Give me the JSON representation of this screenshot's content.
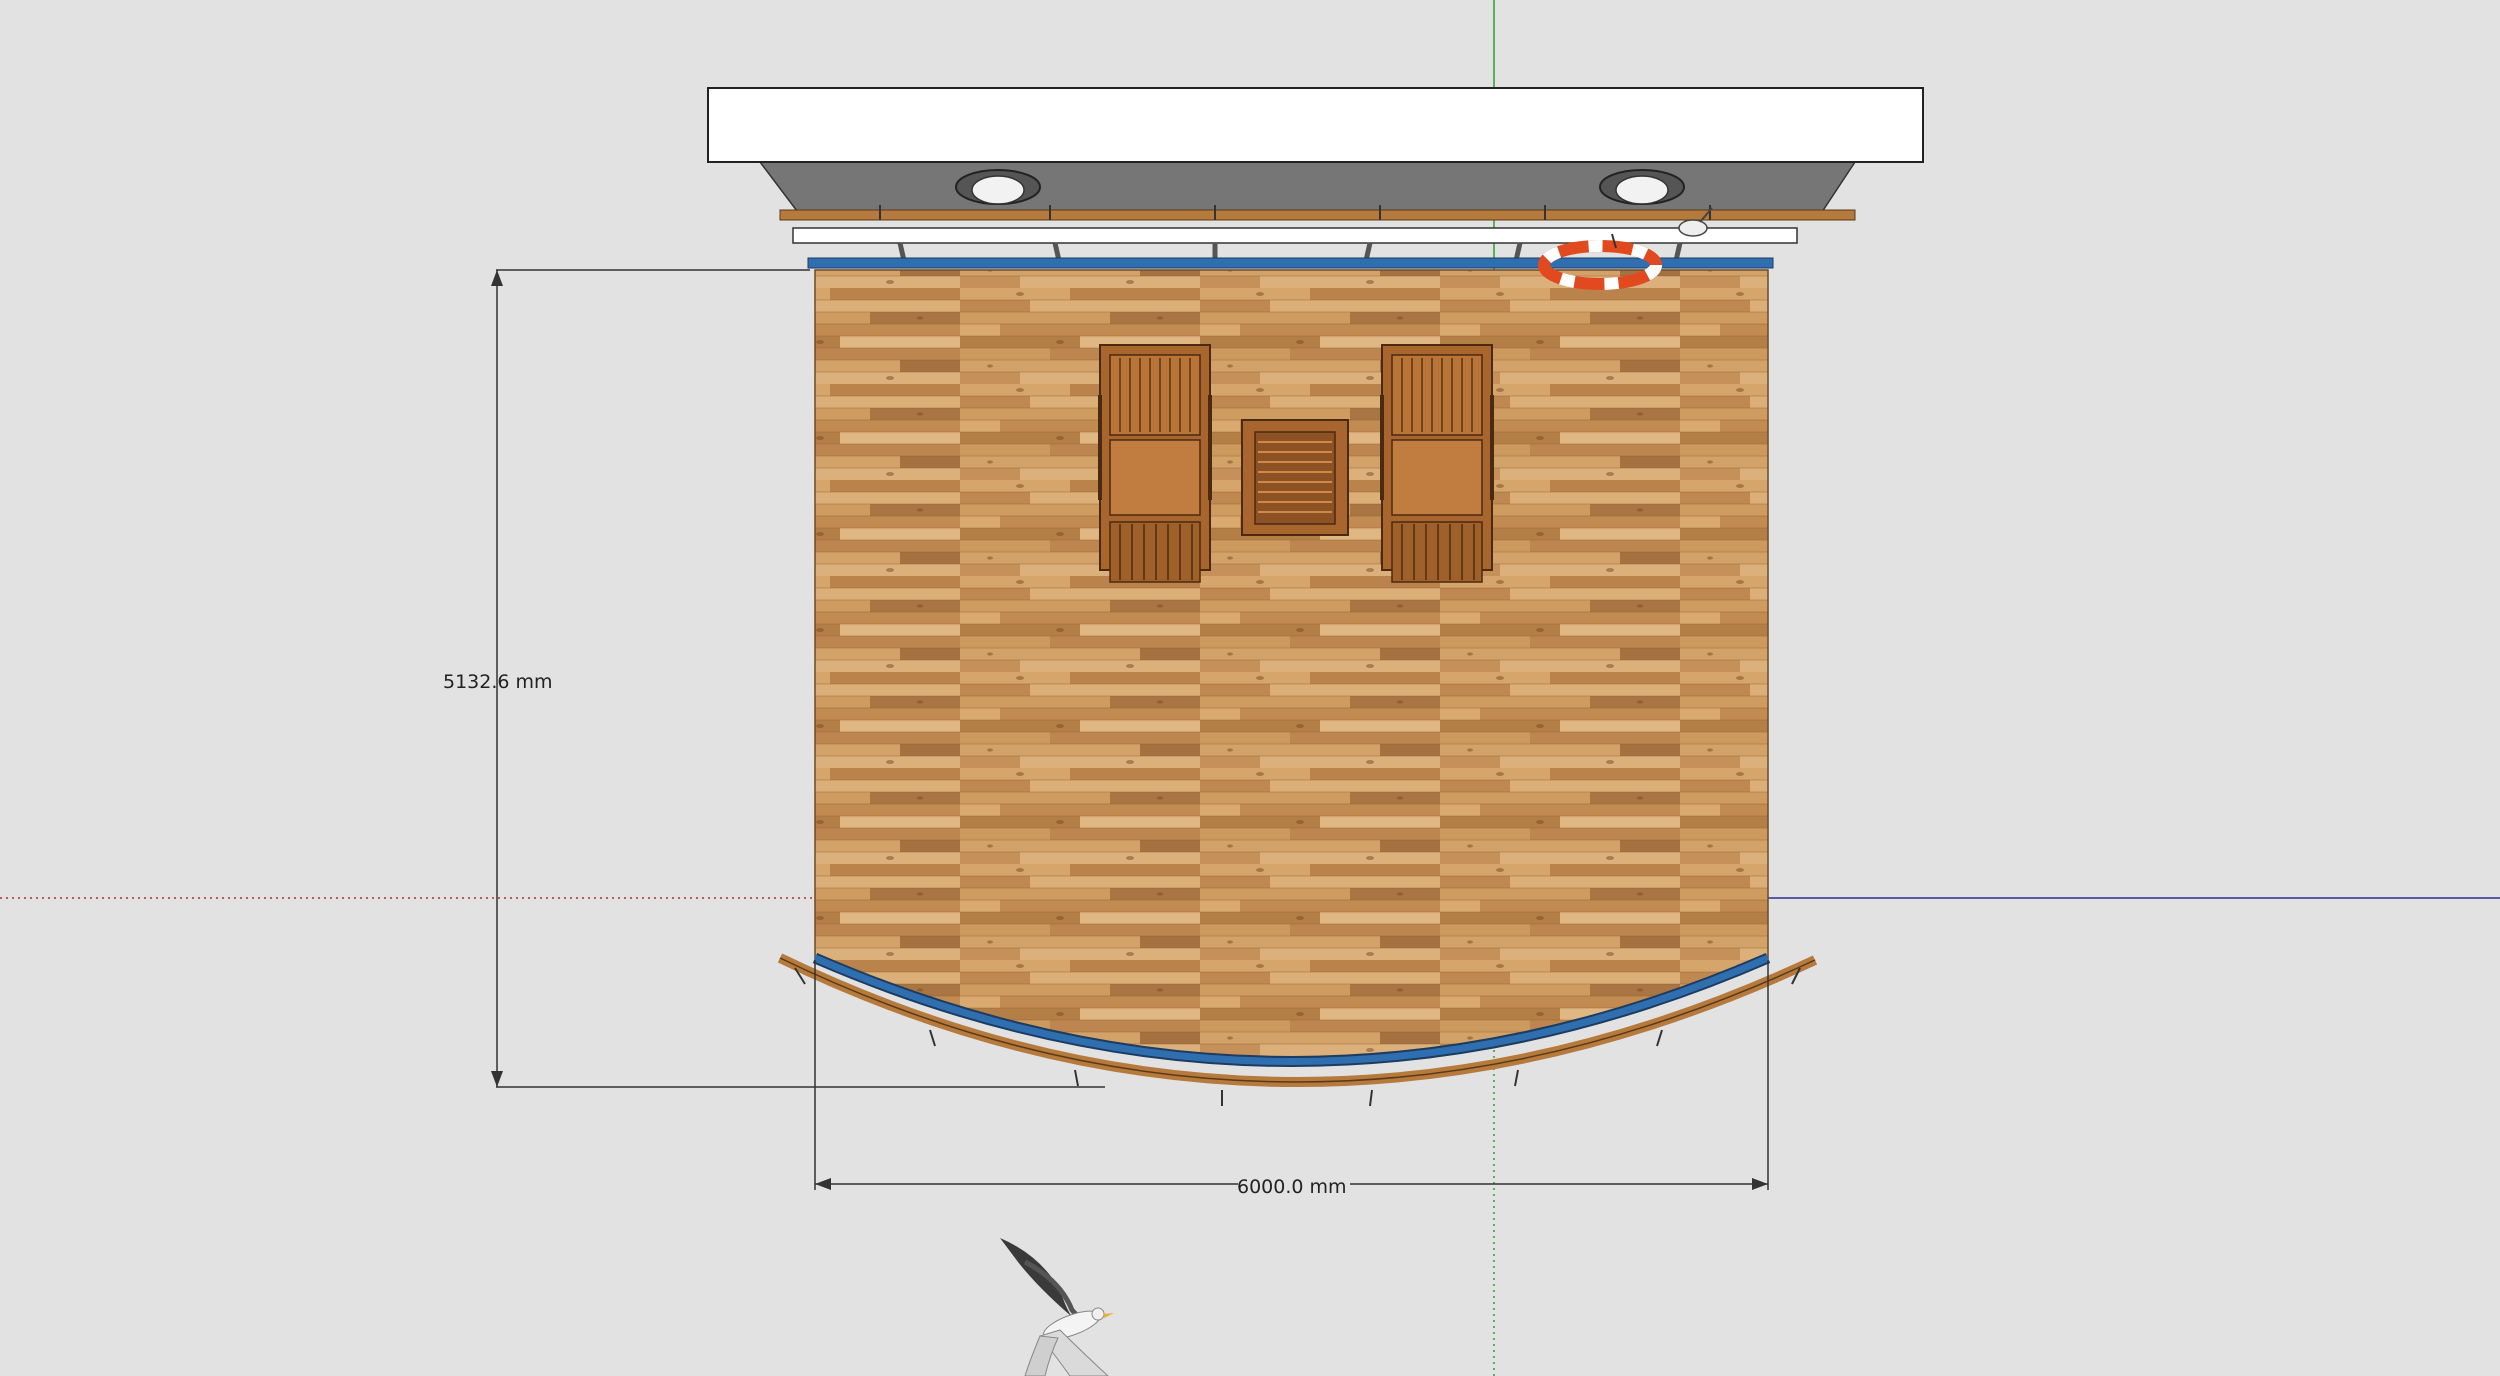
{
  "viewport": {
    "background": "#e2e2e2"
  },
  "dimensions": {
    "depth_label": "5132.6 mm",
    "width_label": "6000.0 mm"
  },
  "axes": {
    "green_axis_color": "#2fa02f",
    "blue_axis_color": "#2c2c8c",
    "red_axis_color": "#b03030"
  },
  "model": {
    "deck_color": "#c08a4e",
    "rail_color": "#2f6fb0",
    "roof_color": "#ffffff",
    "soffit_color": "#7a7a7a",
    "lifebuoy_color": "#e04a1e",
    "icons": [
      "ceiling-light-icon",
      "lifebuoy-icon",
      "lounge-chair-icon",
      "side-table-icon",
      "seagull-icon"
    ]
  }
}
